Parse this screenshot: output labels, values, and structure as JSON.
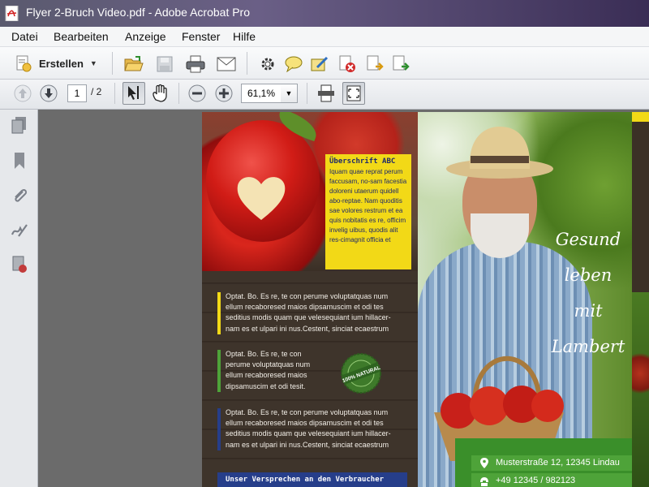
{
  "window": {
    "title": "Flyer 2-Bruch Video.pdf - Adobe Acrobat Pro"
  },
  "menu": [
    "Datei",
    "Bearbeiten",
    "Anzeige",
    "Fenster",
    "Hilfe"
  ],
  "toolbar": {
    "create_label": "Erstellen",
    "icons": [
      "open-icon",
      "save-icon",
      "print-icon",
      "email-icon",
      "settings-icon",
      "comment-icon",
      "sign-icon",
      "delete-page-icon",
      "export-icon",
      "share-icon"
    ]
  },
  "nav": {
    "current_page": "1",
    "page_total": "/ 2",
    "zoom": "61,1%"
  },
  "colors": {
    "accent_yellow": "#f2d917",
    "accent_green": "#4ea339",
    "accent_blue": "#263e8a",
    "wood": "#3e342b"
  },
  "document": {
    "yellow_box": {
      "title": "Überschrift ABC",
      "body": "Iquam quae reprat perum faccusam, no-sam facestia doloreni utaerum quidell abo-reptae. Nam quoditis sae volores restrum et ea quis nobitatis es re, officim invelig uibus, quodis alit res-cimagnit officia et"
    },
    "paragraphs": [
      {
        "lines": [
          "Optat. Bo. Es re, te con perume voluptatquas num",
          "ellum recaboresed maios dipsamuscim et odi tes",
          "seditius modis quam que velesequiant ium hillacer-",
          "nam es et ulpari ini nus.Cestent, sinciat ecaestrum"
        ]
      },
      {
        "lines": [
          "Optat. Bo. Es re, te con",
          "perume voluptatquas num",
          "ellum recaboresed maios",
          "dipsamuscim et odi tesit."
        ]
      },
      {
        "lines": [
          "Optat. Bo. Es re, te con perume voluptatquas num",
          "ellum recaboresed maios dipsamuscim et odi tes",
          "seditius modis quam que velesequiant ium hillacer-",
          "nam es et ulpari ini nus.Cestent, sinciat ecaestrum"
        ]
      }
    ],
    "badge_text": "100% NATURAL",
    "banner": "Unser Versprechen an den Verbraucher",
    "headline": [
      "Gesund",
      "leben mit",
      "Lambert"
    ],
    "contact": {
      "address": "Musterstraße 12, 12345 Lindau",
      "phone": "+49 12345 / 982123"
    }
  }
}
